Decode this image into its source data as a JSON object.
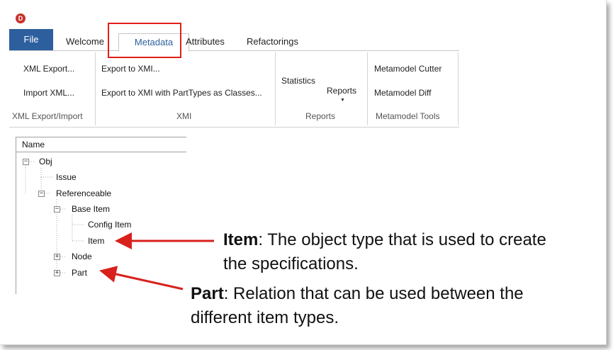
{
  "ribbon": {
    "tabs": [
      "File",
      "Welcome",
      "Metadata",
      "Attributes",
      "Refactorings"
    ],
    "buttons": {
      "xml_export": "XML Export...",
      "import_xml": "Import XML...",
      "export_xmi": "Export to XMI...",
      "export_xmi_parttypes": "Export to XMI with PartTypes as Classes...",
      "statistics": "Statistics",
      "reports": "Reports",
      "metamodel_cutter": "Metamodel Cutter",
      "metamodel_diff": "Metamodel Diff"
    },
    "groups": [
      "XML Export/Import",
      "XMI",
      "Reports",
      "Metamodel Tools"
    ],
    "highlight_color": "#e0201b"
  },
  "tree": {
    "header": "Name",
    "nodes": [
      "Obj",
      "Issue",
      "Referenceable",
      "Base Item",
      "Config Item",
      "Item",
      "Node",
      "Part"
    ]
  },
  "annotations": {
    "item": {
      "term": "Item",
      "line1": ": The object type that is used to create",
      "line2": "the specifications."
    },
    "part": {
      "term": "Part",
      "line1": ": Relation that can be used between the",
      "line2": "different item types."
    },
    "arrow_color": "#d8211c"
  }
}
